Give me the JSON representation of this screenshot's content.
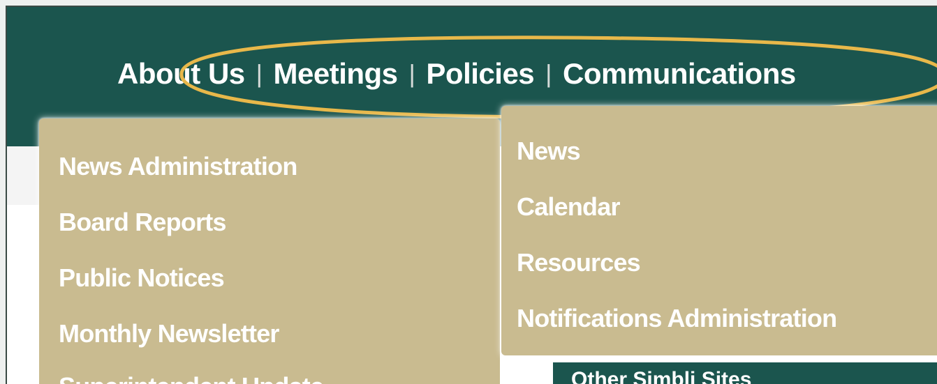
{
  "nav": {
    "items": [
      "About Us",
      "Meetings",
      "Policies",
      "Communications"
    ],
    "separator": "|"
  },
  "menus": {
    "left": [
      "News Administration",
      "Board Reports",
      "Public Notices",
      "Monthly Newsletter",
      "Superintendent Update"
    ],
    "right": [
      "News",
      "Calendar",
      "Resources",
      "Notifications Administration"
    ]
  },
  "footer": {
    "other_sites": "Other Simbli Sites"
  },
  "colors": {
    "header": "#1b554e",
    "menu": "#c9bb90",
    "highlight_ring": "#e8b84a"
  }
}
